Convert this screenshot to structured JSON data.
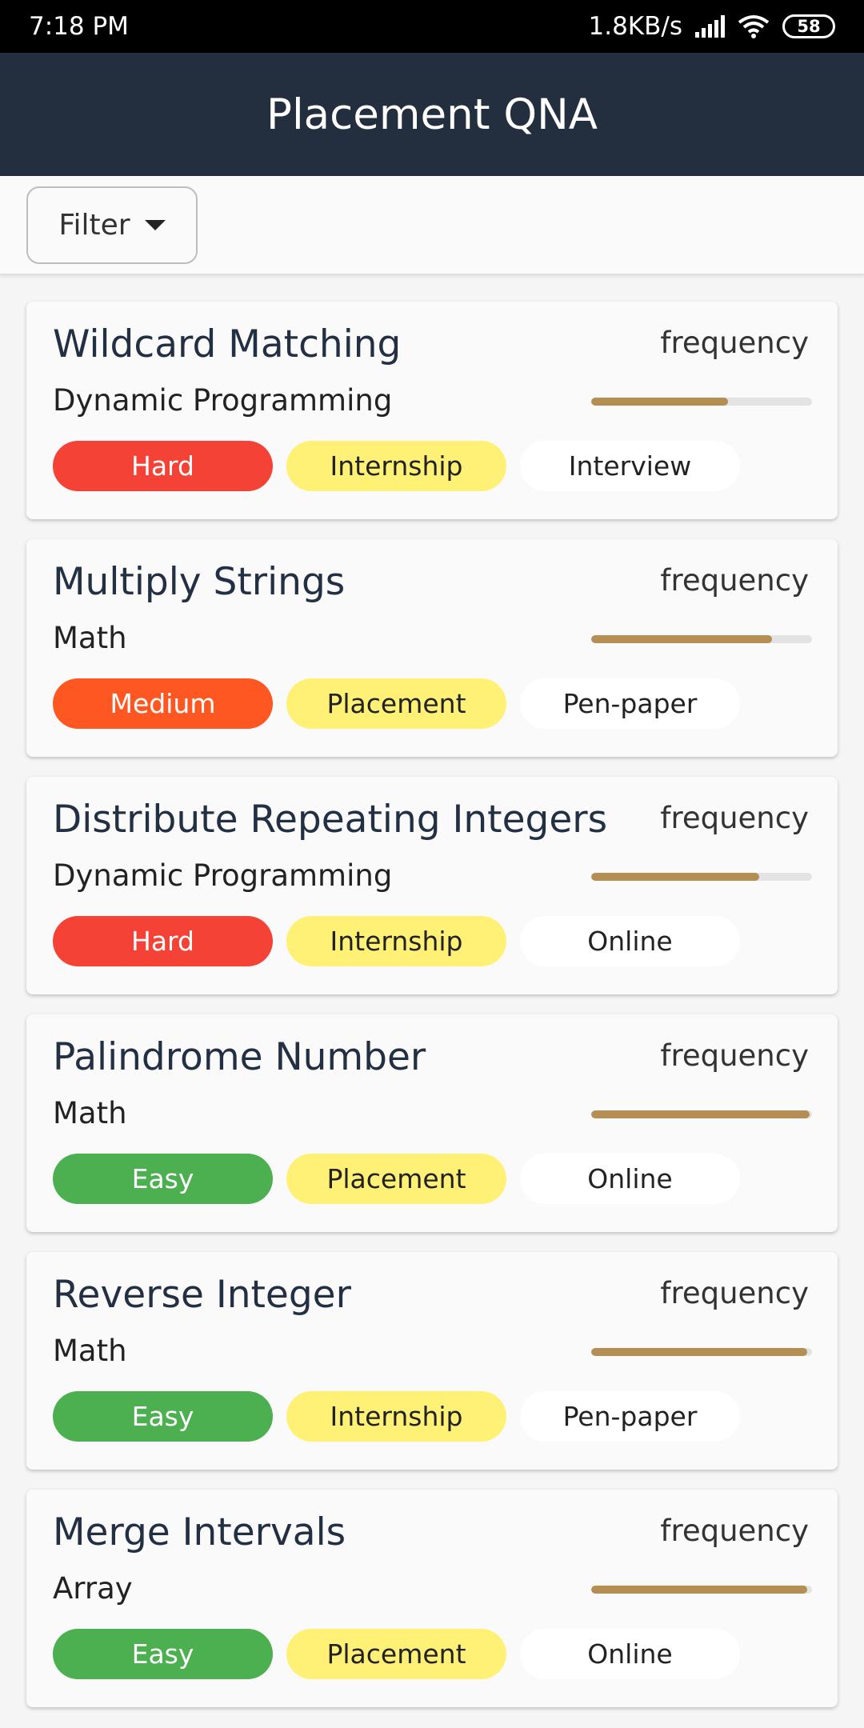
{
  "status_bar": {
    "time": "7:18 PM",
    "network_speed": "1.8KB/s",
    "battery": "58",
    "icons": [
      "signal-icon",
      "wifi-icon",
      "battery-icon"
    ]
  },
  "app_bar": {
    "title": "Placement QNA"
  },
  "filter": {
    "label": "Filter",
    "icon": "caret-down-icon"
  },
  "colors": {
    "app_bar": "#232f3e",
    "hard": "#f44336",
    "medium": "#ff5722",
    "easy": "#4caf50",
    "type_chip": "#fff176",
    "frequency_bar": "#b48e52"
  },
  "questions": [
    {
      "title": "Wildcard Matching",
      "topic": "Dynamic Programming",
      "frequency_label": "frequency",
      "frequency": 0.62,
      "difficulty": "Hard",
      "difficulty_color": "#f44336",
      "type": "Internship",
      "round": "Interview"
    },
    {
      "title": "Multiply Strings",
      "topic": "Math",
      "frequency_label": "frequency",
      "frequency": 0.82,
      "difficulty": "Medium",
      "difficulty_color": "#ff5722",
      "type": "Placement",
      "round": "Pen-paper"
    },
    {
      "title": "Distribute Repeating Integers",
      "topic": "Dynamic Programming",
      "frequency_label": "frequency",
      "frequency": 0.76,
      "difficulty": "Hard",
      "difficulty_color": "#f44336",
      "type": "Internship",
      "round": "Online"
    },
    {
      "title": "Palindrome Number",
      "topic": "Math",
      "frequency_label": "frequency",
      "frequency": 0.99,
      "difficulty": "Easy",
      "difficulty_color": "#4caf50",
      "type": "Placement",
      "round": "Online"
    },
    {
      "title": "Reverse Integer",
      "topic": "Math",
      "frequency_label": "frequency",
      "frequency": 0.98,
      "difficulty": "Easy",
      "difficulty_color": "#4caf50",
      "type": "Internship",
      "round": "Pen-paper"
    },
    {
      "title": "Merge Intervals",
      "topic": "Array",
      "frequency_label": "frequency",
      "frequency": 0.98,
      "difficulty": "Easy",
      "difficulty_color": "#4caf50",
      "type": "Placement",
      "round": "Online"
    }
  ]
}
